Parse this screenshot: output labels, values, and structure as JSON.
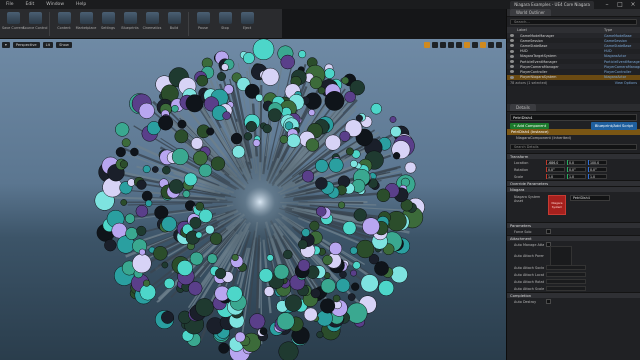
{
  "menu": [
    "File",
    "Edit",
    "Window",
    "Help"
  ],
  "title_tab": "Niagara Examples - UE4 Core Niagara",
  "toolbar": [
    {
      "label": "Save Current",
      "icon": "save-icon"
    },
    {
      "label": "Source Control",
      "icon": "source-control-icon"
    },
    {
      "label": "Content",
      "icon": "content-icon"
    },
    {
      "label": "Marketplace",
      "icon": "marketplace-icon"
    },
    {
      "label": "Settings",
      "icon": "settings-icon"
    },
    {
      "label": "Blueprints",
      "icon": "blueprints-icon"
    },
    {
      "label": "Cinematics",
      "icon": "cinematics-icon"
    },
    {
      "label": "Build",
      "icon": "build-icon"
    },
    {
      "label": "Pause",
      "icon": "pause-icon"
    },
    {
      "label": "Stop",
      "icon": "stop-icon"
    },
    {
      "label": "Eject",
      "icon": "eject-icon"
    }
  ],
  "viewport": {
    "mode_label": "Perspective",
    "lit_label": "Lit",
    "show_label": "Show"
  },
  "outliner": {
    "tab": "World Outliner",
    "search_placeholder": "Search...",
    "col_label": "Label",
    "col_type": "Type",
    "rows": [
      {
        "name": "GameModeManager",
        "type": "GameModeBase"
      },
      {
        "name": "GameSession",
        "type": "GameSession"
      },
      {
        "name": "GameStateBase",
        "type": "GameStateBase"
      },
      {
        "name": "HUD",
        "type": "HUD"
      },
      {
        "name": "NiagaraTargetSystem",
        "type": "NiagaraActor"
      },
      {
        "name": "ParticleEventManager",
        "type": "ParticleEventManager"
      },
      {
        "name": "PlayerCameraManager",
        "type": "PlayerCameraManager"
      },
      {
        "name": "PlayerController",
        "type": "PlayerController"
      },
      {
        "name": "PlayerNiagaraSystem",
        "type": "NiagaraActor"
      }
    ],
    "footer_count": "78 actors (1 selected)",
    "footer_view": "View Options"
  },
  "details": {
    "tab": "Details",
    "actor_name": "PetriDish4",
    "bp_button": "Blueprint/Add Script",
    "add_component": "+ Add Component",
    "self_row": "PetriDish4 (Instance)",
    "component_row": "NiagaraComponent (Inherited)",
    "search_placeholder": "Search Details",
    "transform": {
      "category": "Transform",
      "location_label": "Location",
      "rotation_label": "Rotation",
      "scale_label": "Scale",
      "location": [
        "-686.0",
        "0.0",
        "100.0"
      ],
      "rotation": [
        "0.0°",
        "0.0°",
        "0.0°"
      ],
      "scale": [
        "1.0",
        "1.0",
        "1.0"
      ]
    },
    "override_category": "Override Parameters",
    "niagara_category": "Niagara",
    "niagara_asset_label": "Niagara System Asset",
    "niagara_asset_value": "PetriDish4",
    "niagara_thumb": "Niagara System",
    "parameters_category": "Parameters",
    "force_solo_label": "Force Solo",
    "attachment_category": "Attachment",
    "auto_manage_label": "Auto Manage Attachment",
    "auto_attach_parent_label": "Auto Attach Parent",
    "auto_attach_socket_label": "Auto Attach Socket Name",
    "auto_attach_loc_label": "Auto Attach Location Rule",
    "auto_attach_rot_label": "Auto Attach Rotation Rule",
    "auto_attach_scale_label": "Auto Attach Scale Rule",
    "completion_category": "Completion",
    "auto_destroy_label": "Auto Destroy"
  },
  "colors": {
    "accent": "#d08a1f",
    "selection": "#7a5614",
    "blueprint_button": "#1f5f9e"
  }
}
